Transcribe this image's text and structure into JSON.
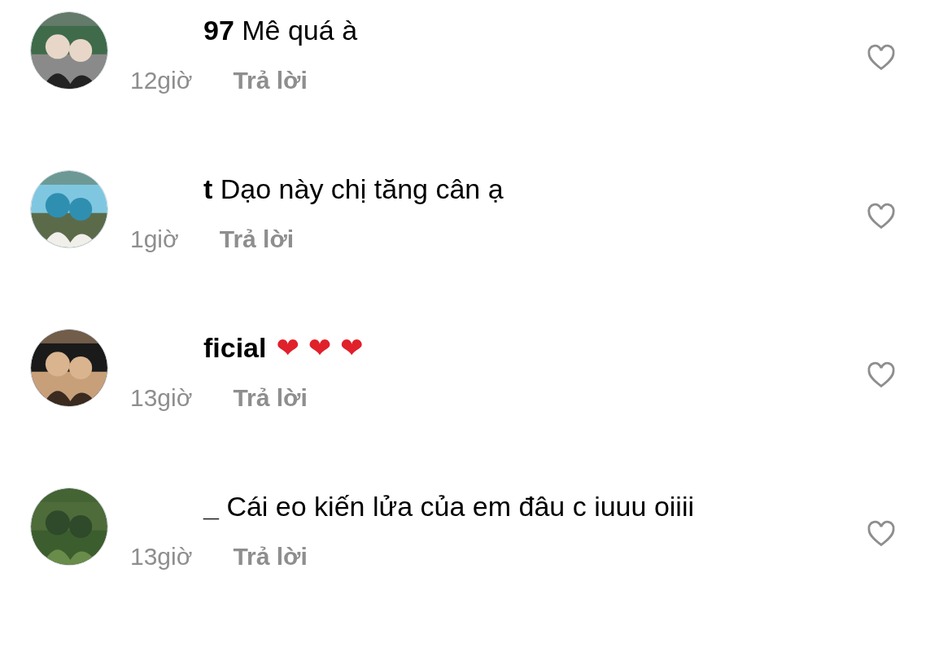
{
  "comments": [
    {
      "username": "97",
      "text": "Mê quá à",
      "time": "12giờ",
      "reply": "Trả lời"
    },
    {
      "username": "t",
      "text": "Dạo này chị tăng cân ạ",
      "time": "1giờ",
      "reply": "Trả lời"
    },
    {
      "username": "ficial",
      "emoji": "❤ ❤ ❤",
      "time": "13giờ",
      "reply": "Trả lời"
    },
    {
      "username": "_",
      "text": "Cái eo kiến lửa của em đâu c iuuu oiiii",
      "time": "13giờ",
      "reply": "Trả lời"
    }
  ]
}
